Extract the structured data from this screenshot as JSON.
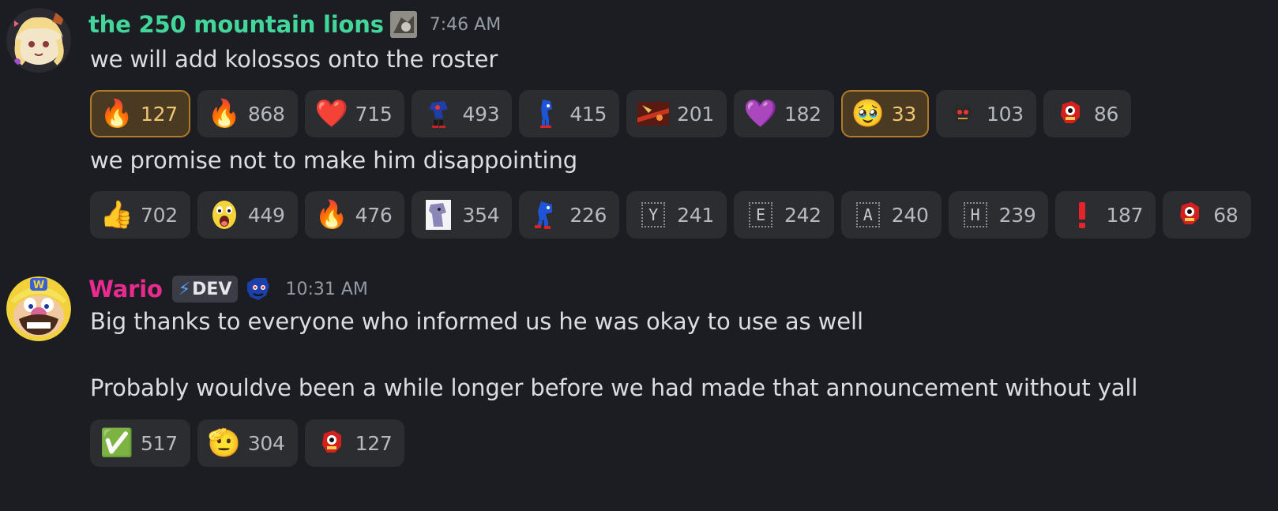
{
  "messages": [
    {
      "username": "the 250 mountain lions",
      "username_color": "#43d69a",
      "timestamp": "7:46 AM",
      "lines": [
        {
          "text": "we will add kolossos onto the roster",
          "reactions": [
            {
              "emoji": "🔥",
              "count": "127",
              "me": true
            },
            {
              "emoji": "🔥",
              "count": "868",
              "me": false
            },
            {
              "emoji": "❤️",
              "count": "715",
              "me": false
            },
            {
              "emoji": "sonic-exe-sprite",
              "count": "493",
              "me": false
            },
            {
              "emoji": "sonic-sprite",
              "count": "415",
              "me": false
            },
            {
              "emoji": "red-scene",
              "count": "201",
              "me": false
            },
            {
              "emoji": "💜",
              "count": "182",
              "me": false
            },
            {
              "emoji": "🥹",
              "count": "33",
              "me": true
            },
            {
              "emoji": "dark-creature",
              "count": "103",
              "me": false
            },
            {
              "emoji": "knuckles-sprite",
              "count": "86",
              "me": false
            }
          ]
        },
        {
          "text": "we promise not to make him disappointing",
          "reactions": [
            {
              "emoji": "👍",
              "count": "702",
              "me": false
            },
            {
              "emoji": "😮",
              "count": "449",
              "me": false
            },
            {
              "emoji": "🔥",
              "count": "476",
              "me": false
            },
            {
              "emoji": "sonic-portrait",
              "count": "354",
              "me": false
            },
            {
              "emoji": "sonic-run",
              "count": "226",
              "me": false
            },
            {
              "emoji": "Y",
              "count": "241",
              "me": false
            },
            {
              "emoji": "E",
              "count": "242",
              "me": false
            },
            {
              "emoji": "A",
              "count": "240",
              "me": false
            },
            {
              "emoji": "H",
              "count": "239",
              "me": false
            },
            {
              "emoji": "❗",
              "count": "187",
              "me": false
            },
            {
              "emoji": "knuckles-sprite",
              "count": "68",
              "me": false
            }
          ]
        }
      ]
    },
    {
      "username": "Wario",
      "username_color": "#e92a8f",
      "badge": "DEV",
      "timestamp": "10:31 AM",
      "lines": [
        {
          "text": "Big thanks to everyone who informed us he was okay to use as well"
        },
        {
          "text": "Probably wouldve been a while longer before we had made that announcement without yall",
          "reactions": [
            {
              "emoji": "✅",
              "count": "517",
              "me": false
            },
            {
              "emoji": "🫡",
              "count": "304",
              "me": false
            },
            {
              "emoji": "knuckles-sprite",
              "count": "127",
              "me": false
            }
          ]
        }
      ]
    }
  ]
}
